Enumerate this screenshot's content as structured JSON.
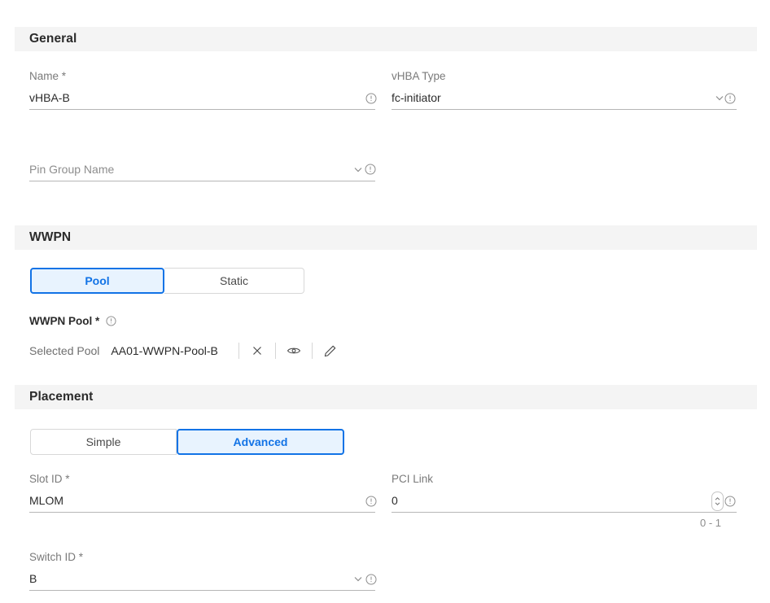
{
  "sections": [
    {
      "id": "general",
      "title": "General"
    },
    {
      "id": "wwpn",
      "title": "WWPN"
    },
    {
      "id": "placement",
      "title": "Placement"
    }
  ],
  "general": {
    "name_field": {
      "label": "Name *",
      "value": "vHBA-B",
      "info_icon": "info-icon"
    },
    "vhba_type_field": {
      "label": "vHBA Type",
      "value": "fc-initiator",
      "chevron_icon": "chevron-down-icon",
      "info_icon": "info-icon"
    },
    "pin_group_field": {
      "label": "",
      "placeholder": "Pin Group Name",
      "chevron_icon": "chevron-down-icon",
      "info_icon": "info-icon"
    }
  },
  "wwpn": {
    "mode_toggle": {
      "options": [
        "Pool",
        "Static"
      ],
      "selected": "Pool"
    },
    "pool_label": "WWPN Pool *",
    "pool_label_info_icon": "info-icon",
    "selected_pool_caption": "Selected Pool",
    "selected_pool_name": "AA01-WWPN-Pool-B",
    "actions": [
      {
        "name": "clear-pool-button",
        "icon": "close-icon"
      },
      {
        "name": "view-pool-button",
        "icon": "eye-icon"
      },
      {
        "name": "edit-pool-button",
        "icon": "pencil-icon"
      }
    ]
  },
  "placement": {
    "mode_toggle": {
      "options": [
        "Simple",
        "Advanced"
      ],
      "selected": "Advanced"
    },
    "slot_id_field": {
      "label": "Slot ID *",
      "value": "MLOM",
      "info_icon": "info-icon"
    },
    "pci_link_field": {
      "label": "PCI Link",
      "value": "0",
      "hint": "0 - 1",
      "stepper_icon": "stepper-updown-icon",
      "info_icon": "info-icon"
    },
    "switch_id_field": {
      "label": "Switch ID *",
      "value": "B",
      "chevron_icon": "chevron-down-icon",
      "info_icon": "info-icon"
    }
  },
  "colors": {
    "accent": "#1273e6",
    "accent_fill": "#e8f3fe",
    "band": "#f4f4f4",
    "text": "#2b2b2b",
    "muted": "#7a7a7a",
    "underline": "#b6b6b6"
  }
}
